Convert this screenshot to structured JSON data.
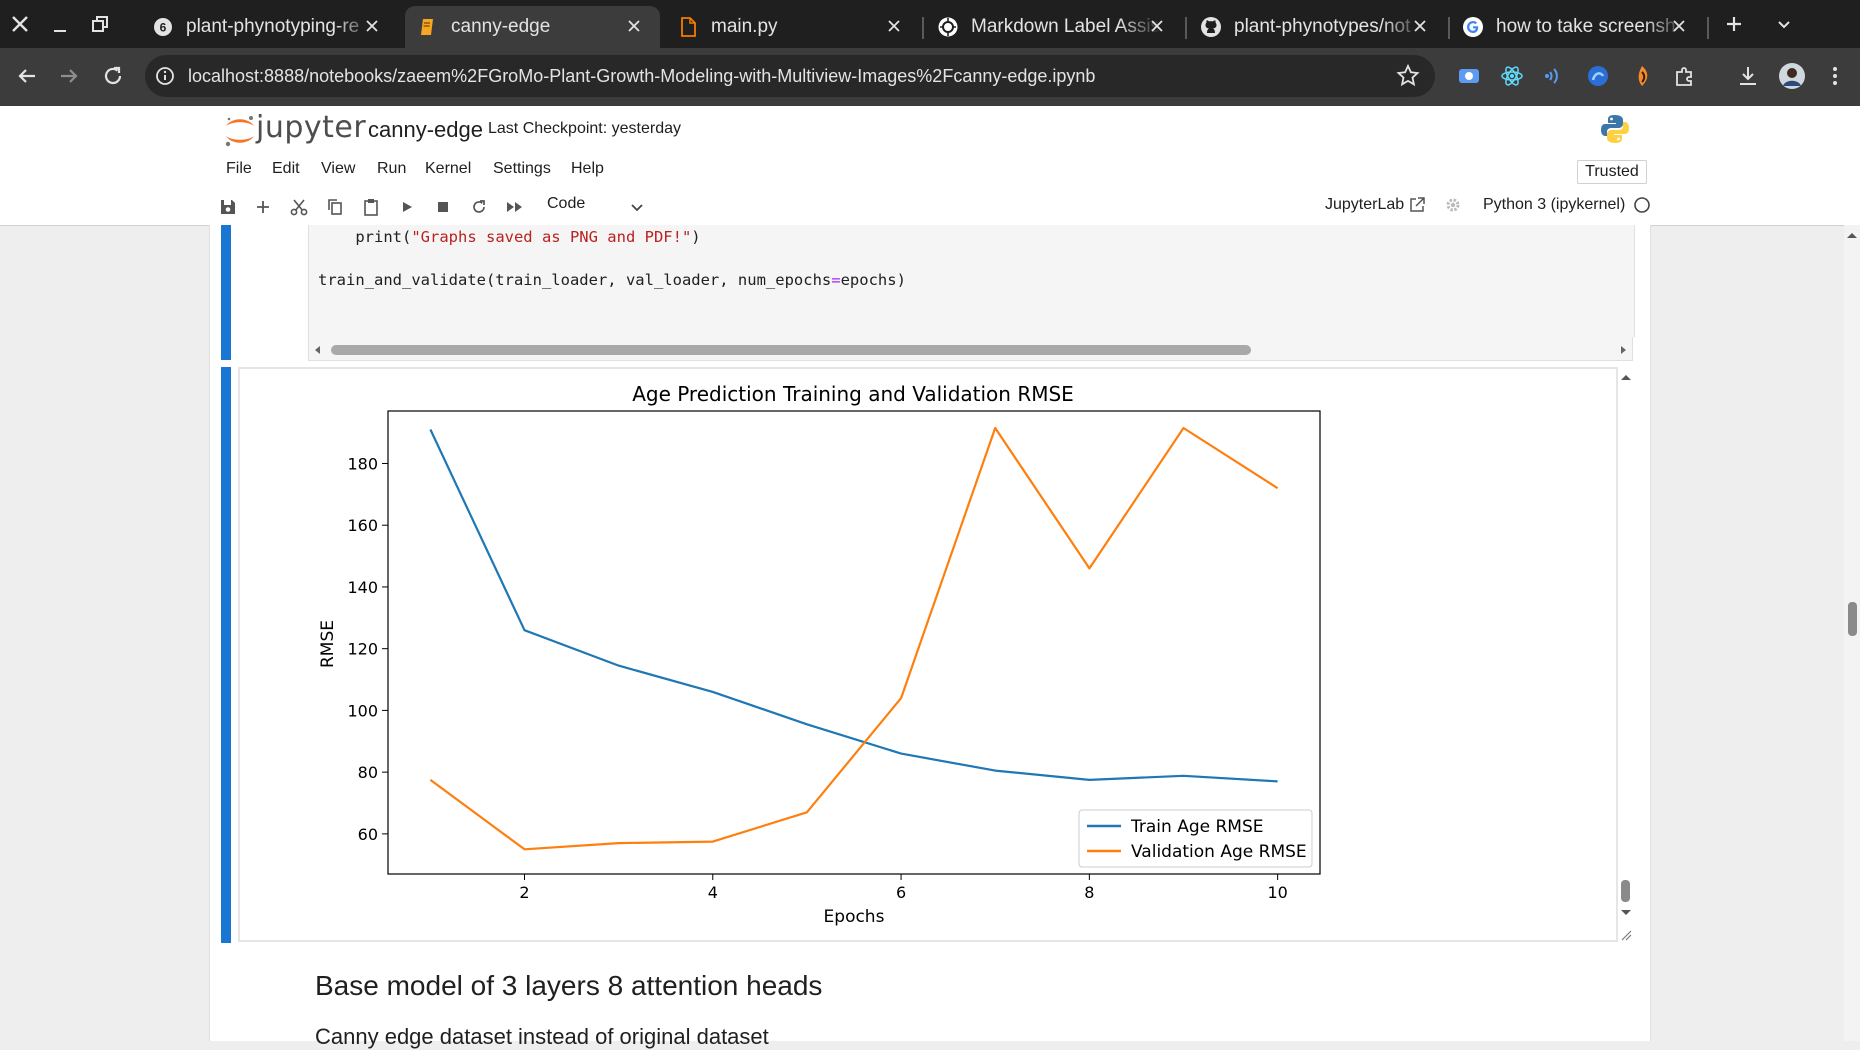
{
  "browser": {
    "tabs": [
      {
        "title": "plant-phynotyping-re",
        "icon": "wandb-icon",
        "active": false
      },
      {
        "title": "canny-edge",
        "icon": "jupyter-notebook-icon",
        "active": true
      },
      {
        "title": "main.py",
        "icon": "file-icon",
        "active": false
      },
      {
        "title": "Markdown Label Assis",
        "icon": "openai-icon",
        "active": false
      },
      {
        "title": "plant-phynotypes/not",
        "icon": "github-icon",
        "active": false
      },
      {
        "title": "how to take screensh",
        "icon": "google-icon",
        "active": false
      }
    ],
    "url": "localhost:8888/notebooks/zaeem%2FGroMo-Plant-Growth-Modeling-with-Multiview-Images%2Fcanny-edge.ipynb"
  },
  "jupyter": {
    "logo_text": "jupyter",
    "notebook_name": "canny-edge",
    "checkpoint": "Last Checkpoint: yesterday",
    "menu": [
      "File",
      "Edit",
      "View",
      "Run",
      "Kernel",
      "Settings",
      "Help"
    ],
    "trusted": "Trusted",
    "cell_type": "Code",
    "jupyterlab_link": "JupyterLab",
    "kernel": "Python 3 (ipykernel)"
  },
  "code": {
    "line1_pre": "    print(",
    "line1_str": "\"Graphs saved as PNG and PDF!\"",
    "line1_post": ")",
    "line2_pre": "train_and_validate(train_loader, val_loader, num_epochs",
    "line2_op": "=",
    "line2_post": "epochs)"
  },
  "markdown": {
    "heading": "Base model of 3 layers 8 attention heads",
    "paragraph": "Canny edge dataset instead of original dataset"
  },
  "chart_data": {
    "type": "line",
    "title": "Age Prediction Training and Validation RMSE",
    "xlabel": "Epochs",
    "ylabel": "RMSE",
    "x": [
      1,
      2,
      3,
      4,
      5,
      6,
      7,
      8,
      9,
      10
    ],
    "xticks": [
      2,
      4,
      6,
      8,
      10
    ],
    "yticks": [
      60,
      80,
      100,
      120,
      140,
      160,
      180
    ],
    "xlim": [
      0.55,
      10.45
    ],
    "ylim": [
      47,
      197
    ],
    "legend_position": "lower-right",
    "series": [
      {
        "name": "Train Age RMSE",
        "color": "#1f77b4",
        "values": [
          191,
          126,
          114.5,
          106,
          95.5,
          86,
          80.5,
          77.5,
          78.8,
          77
        ]
      },
      {
        "name": "Validation Age RMSE",
        "color": "#ff7f0e",
        "values": [
          77.5,
          55,
          57,
          57.5,
          67,
          104,
          191.5,
          146,
          191.5,
          172
        ]
      }
    ]
  }
}
